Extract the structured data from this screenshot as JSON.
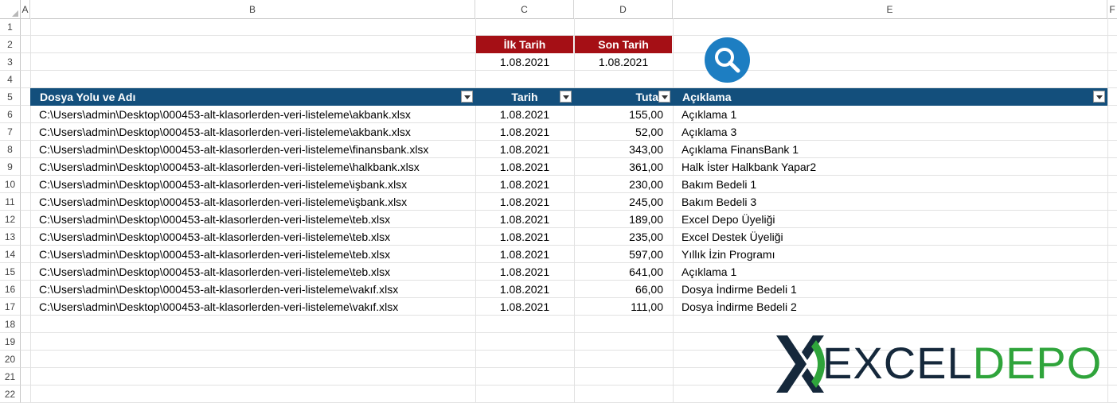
{
  "columns": [
    "A",
    "B",
    "C",
    "D",
    "E",
    "F"
  ],
  "rows": [
    "1",
    "2",
    "3",
    "4",
    "5",
    "6",
    "7",
    "8",
    "9",
    "10",
    "11",
    "12",
    "13",
    "14",
    "15",
    "16",
    "17",
    "18",
    "19",
    "20",
    "21",
    "22"
  ],
  "date_filter": {
    "start_label": "İlk Tarih",
    "end_label": "Son Tarih",
    "start_value": "1.08.2021",
    "end_value": "1.08.2021"
  },
  "table": {
    "headers": [
      "Dosya Yolu ve Adı",
      "Tarih",
      "Tutar",
      "Açıklama"
    ],
    "amount_header_visible": "Tuta",
    "rows": [
      {
        "path": "C:\\Users\\admin\\Desktop\\000453-alt-klasorlerden-veri-listeleme\\akbank.xlsx",
        "date": "1.08.2021",
        "amount": "155,00",
        "desc": "Açıklama 1"
      },
      {
        "path": "C:\\Users\\admin\\Desktop\\000453-alt-klasorlerden-veri-listeleme\\akbank.xlsx",
        "date": "1.08.2021",
        "amount": "52,00",
        "desc": "Açıklama 3"
      },
      {
        "path": "C:\\Users\\admin\\Desktop\\000453-alt-klasorlerden-veri-listeleme\\finansbank.xlsx",
        "date": "1.08.2021",
        "amount": "343,00",
        "desc": "Açıklama FinansBank 1"
      },
      {
        "path": "C:\\Users\\admin\\Desktop\\000453-alt-klasorlerden-veri-listeleme\\halkbank.xlsx",
        "date": "1.08.2021",
        "amount": "361,00",
        "desc": "Halk İster Halkbank Yapar2"
      },
      {
        "path": "C:\\Users\\admin\\Desktop\\000453-alt-klasorlerden-veri-listeleme\\işbank.xlsx",
        "date": "1.08.2021",
        "amount": "230,00",
        "desc": "Bakım Bedeli 1"
      },
      {
        "path": "C:\\Users\\admin\\Desktop\\000453-alt-klasorlerden-veri-listeleme\\işbank.xlsx",
        "date": "1.08.2021",
        "amount": "245,00",
        "desc": "Bakım Bedeli 3"
      },
      {
        "path": "C:\\Users\\admin\\Desktop\\000453-alt-klasorlerden-veri-listeleme\\teb.xlsx",
        "date": "1.08.2021",
        "amount": "189,00",
        "desc": "Excel Depo Üyeliği"
      },
      {
        "path": "C:\\Users\\admin\\Desktop\\000453-alt-klasorlerden-veri-listeleme\\teb.xlsx",
        "date": "1.08.2021",
        "amount": "235,00",
        "desc": "Excel Destek Üyeliği"
      },
      {
        "path": "C:\\Users\\admin\\Desktop\\000453-alt-klasorlerden-veri-listeleme\\teb.xlsx",
        "date": "1.08.2021",
        "amount": "597,00",
        "desc": "Yıllık İzin Programı"
      },
      {
        "path": "C:\\Users\\admin\\Desktop\\000453-alt-klasorlerden-veri-listeleme\\teb.xlsx",
        "date": "1.08.2021",
        "amount": "641,00",
        "desc": "Açıklama 1"
      },
      {
        "path": "C:\\Users\\admin\\Desktop\\000453-alt-klasorlerden-veri-listeleme\\vakıf.xlsx",
        "date": "1.08.2021",
        "amount": "66,00",
        "desc": "Dosya İndirme Bedeli 1"
      },
      {
        "path": "C:\\Users\\admin\\Desktop\\000453-alt-klasorlerden-veri-listeleme\\vakıf.xlsx",
        "date": "1.08.2021",
        "amount": "111,00",
        "desc": "Dosya İndirme Bedeli 2"
      }
    ]
  },
  "search_button": {
    "icon": "search-icon"
  },
  "logo": {
    "part1": "EXCEL",
    "part2": "DEPO",
    "color_dark": "#15283b",
    "color_green": "#2fa43b"
  },
  "colors": {
    "red_header": "#a50f15",
    "table_header": "#134f7c",
    "search_blue": "#1d7ec2"
  }
}
